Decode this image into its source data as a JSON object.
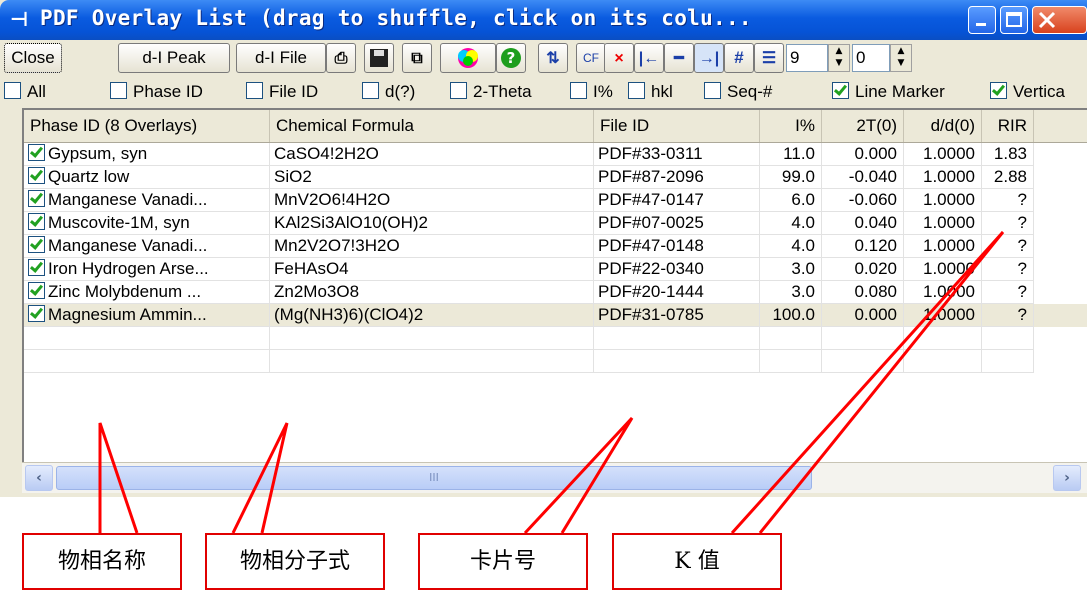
{
  "window": {
    "title": "PDF Overlay List (drag to shuffle, click on its colu..."
  },
  "toolbar": {
    "close_label": "Close",
    "dpeak_label": "d-I Peak",
    "dfile_label": "d-I File",
    "cf_label": "CF",
    "hash_label": "#",
    "spin1_value": "9",
    "spin2_value": "0"
  },
  "options": {
    "all": "All",
    "phase_id": "Phase ID",
    "file_id": "File ID",
    "d": "d(?)",
    "two_theta": "2-Theta",
    "i_pct": "I%",
    "hkl": "hkl",
    "seq": "Seq-#",
    "line_marker": "Line Marker",
    "vertical": "Vertica"
  },
  "table": {
    "headers": [
      "Phase ID (8 Overlays)",
      "Chemical Formula",
      "File ID",
      "I%",
      "2T(0)",
      "d/d(0)",
      "RIR"
    ],
    "rows": [
      {
        "phase": "Gypsum, syn",
        "formula": "CaSO4!2H2O",
        "file": "PDF#33-0311",
        "i": "11.0",
        "t2": "0.000",
        "dd": "1.0000",
        "rir": "1.83"
      },
      {
        "phase": "Quartz low",
        "formula": "SiO2",
        "file": "PDF#87-2096",
        "i": "99.0",
        "t2": "-0.040",
        "dd": "1.0000",
        "rir": "2.88"
      },
      {
        "phase": "Manganese Vanadi...",
        "formula": "MnV2O6!4H2O",
        "file": "PDF#47-0147",
        "i": "6.0",
        "t2": "-0.060",
        "dd": "1.0000",
        "rir": "?"
      },
      {
        "phase": "Muscovite-1M, syn",
        "formula": "KAl2Si3AlO10(OH)2",
        "file": "PDF#07-0025",
        "i": "4.0",
        "t2": "0.040",
        "dd": "1.0000",
        "rir": "?"
      },
      {
        "phase": "Manganese Vanadi...",
        "formula": "Mn2V2O7!3H2O",
        "file": "PDF#47-0148",
        "i": "4.0",
        "t2": "0.120",
        "dd": "1.0000",
        "rir": "?"
      },
      {
        "phase": "Iron Hydrogen Arse...",
        "formula": "FeHAsO4",
        "file": "PDF#22-0340",
        "i": "3.0",
        "t2": "0.020",
        "dd": "1.0000",
        "rir": "?"
      },
      {
        "phase": "Zinc Molybdenum ...",
        "formula": "Zn2Mo3O8",
        "file": "PDF#20-1444",
        "i": "3.0",
        "t2": "0.080",
        "dd": "1.0000",
        "rir": "?"
      },
      {
        "phase": "Magnesium Ammin...",
        "formula": "(Mg(NH3)6)(ClO4)2",
        "file": "PDF#31-0785",
        "i": "100.0",
        "t2": "0.000",
        "dd": "1.0000",
        "rir": "?"
      }
    ]
  },
  "scrollbar": {
    "grip": "III"
  },
  "annotations": {
    "phase_name": "物相名称",
    "formula": "物相分子式",
    "card_no": "卡片号",
    "k_value": "K 值",
    "arrow_color": "#ff0000"
  }
}
